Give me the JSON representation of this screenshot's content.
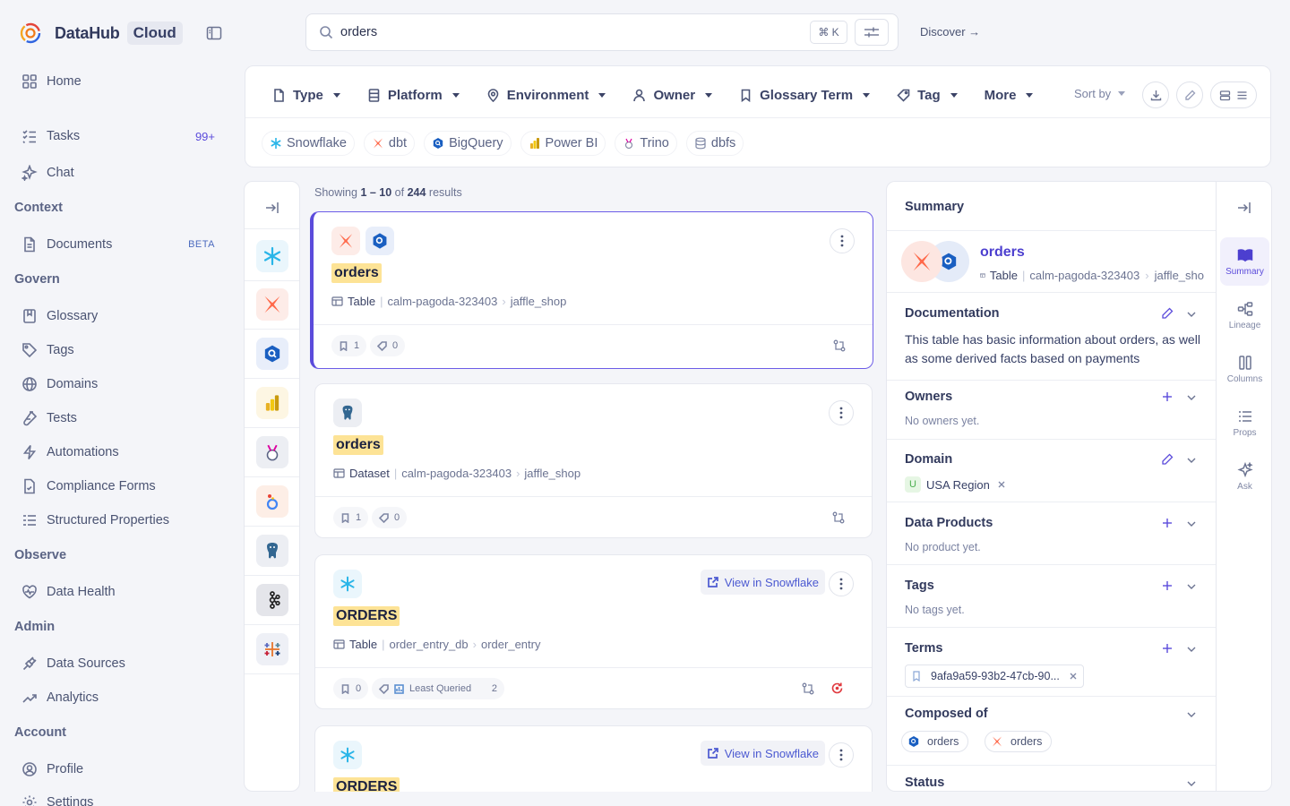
{
  "brand": {
    "name": "DataHub",
    "tag": "Cloud"
  },
  "nav": {
    "home": "Home",
    "tasks": "Tasks",
    "tasks_badge": "99+",
    "chat": "Chat",
    "context": "Context",
    "documents": "Documents",
    "documents_badge": "BETA",
    "govern": "Govern",
    "glossary": "Glossary",
    "tags": "Tags",
    "domains": "Domains",
    "tests": "Tests",
    "automations": "Automations",
    "compliance": "Compliance Forms",
    "structured": "Structured Properties",
    "observe": "Observe",
    "data_health": "Data Health",
    "admin": "Admin",
    "data_sources": "Data Sources",
    "analytics": "Analytics",
    "account": "Account",
    "profile": "Profile",
    "settings": "Settings"
  },
  "search": {
    "value": "orders",
    "shortcut": "⌘ K"
  },
  "discover": "Discover →",
  "filters": {
    "items": [
      "Type",
      "Platform",
      "Environment",
      "Owner",
      "Glossary Term",
      "Tag",
      "More"
    ],
    "sort_by": "Sort by",
    "platforms": [
      "Snowflake",
      "dbt",
      "BigQuery",
      "Power BI",
      "Trino",
      "dbfs"
    ]
  },
  "results": {
    "showing_prefix": "Showing ",
    "range": "1 – 10",
    "of": " of ",
    "total": "244",
    "suffix": " results",
    "cards": [
      {
        "title": "orders",
        "type": "Table",
        "path1": "calm-pagoda-323403",
        "path2": "jaffle_shop",
        "views": "1",
        "tags": "0"
      },
      {
        "title": "orders",
        "type": "Dataset",
        "path1": "calm-pagoda-323403",
        "path2": "jaffle_shop",
        "views": "1",
        "tags": "0"
      },
      {
        "title": "ORDERS",
        "type": "Table",
        "path1": "order_entry_db",
        "path2": "order_entry",
        "views": "0",
        "tag_label": "Least Queried",
        "tags": "2",
        "view_in": "View in Snowflake"
      },
      {
        "title": "ORDERS",
        "view_in": "View in Snowflake"
      }
    ]
  },
  "summary": {
    "title": "Summary",
    "entity": {
      "name": "orders",
      "type": "Table",
      "path1": "calm-pagoda-323403",
      "path2": "jaffle_sho"
    },
    "documentation": {
      "label": "Documentation",
      "text": "This table has basic information about orders, as well as some derived facts based on payments"
    },
    "owners": {
      "label": "Owners",
      "empty": "No owners yet."
    },
    "domain": {
      "label": "Domain",
      "value": "USA Region",
      "letter": "U"
    },
    "data_products": {
      "label": "Data Products",
      "empty": "No product yet."
    },
    "tags": {
      "label": "Tags",
      "empty": "No tags yet."
    },
    "terms": {
      "label": "Terms",
      "value": "9afa9a59-93b2-47cb-90..."
    },
    "composed": {
      "label": "Composed of",
      "a": "orders",
      "b": "orders"
    },
    "status": {
      "label": "Status"
    }
  },
  "rightbar": {
    "summary": "Summary",
    "lineage": "Lineage",
    "columns": "Columns",
    "props": "Props",
    "ask": "Ask"
  }
}
